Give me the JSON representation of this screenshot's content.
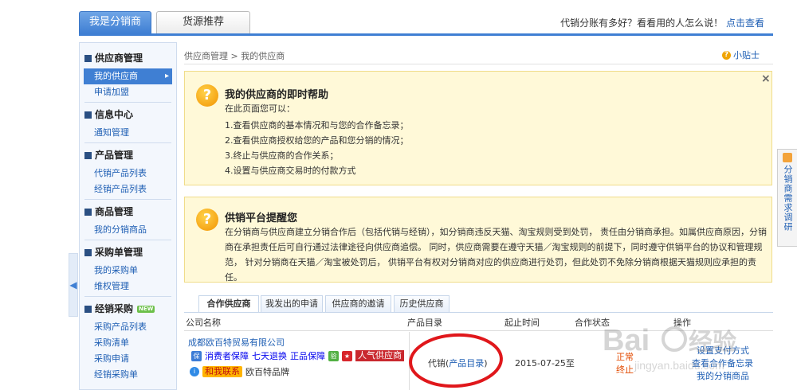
{
  "top_tabs": [
    {
      "label": "我是分销商"
    },
    {
      "label": "货源推荐"
    }
  ],
  "top_promo": {
    "text": "代销分账有多好？看看用的人怎么说！",
    "link": "点击查看"
  },
  "sidebar": {
    "groups": [
      {
        "title": "供应商管理",
        "items": [
          {
            "label": "我的供应商"
          },
          {
            "label": "申请加盟"
          }
        ]
      },
      {
        "title": "信息中心",
        "items": [
          {
            "label": "通知管理"
          }
        ]
      },
      {
        "title": "产品管理",
        "items": [
          {
            "label": "代销产品列表"
          },
          {
            "label": "经销产品列表"
          }
        ]
      },
      {
        "title": "商品管理",
        "items": [
          {
            "label": "我的分销商品"
          }
        ]
      },
      {
        "title": "采购单管理",
        "items": [
          {
            "label": "我的采购单"
          },
          {
            "label": "维权管理"
          }
        ]
      },
      {
        "title": "经销采购",
        "badge": "NEW",
        "items": [
          {
            "label": "采购产品列表"
          },
          {
            "label": "采购清单"
          },
          {
            "label": "采购申请"
          },
          {
            "label": "经销采购单"
          }
        ]
      }
    ]
  },
  "breadcrumb": {
    "parent": "供应商管理",
    "separator": ">",
    "current": "我的供应商"
  },
  "tips_label": "小贴士",
  "help_box_1": {
    "title": "我的供应商的即时帮助",
    "intro": "在此页面您可以：",
    "lines": [
      "1.查看供应商的基本情况和与您的合作备忘录；",
      "2.查看供应商授权给您的产品和您分销的情况；",
      "3.终止与供应商的合作关系；",
      "4.设置与供应商交易时的付款方式"
    ]
  },
  "help_box_2": {
    "title": "供销平台提醒您",
    "text": "在分销商与供应商建立分销合作后（包括代销与经销），如分销商违反天猫、淘宝规则受到处罚， 责任由分销商承担。如属供应商原因，分销商在承担责任后可自行通过法律途径向供应商追偿。 同时，供应商需要在遵守天猫／淘宝规则的前提下，同时遵守供销平台的协议和管理规范， 针对分销商在天猫／淘宝被处罚后， 供销平台有权对分销商对应的供应商进行处罚，但此处罚不免除分销商根据天猫规则应承担的责任。"
  },
  "close_glyph": "×",
  "side_feedback": "分销商需求调研",
  "sub_tabs": [
    {
      "label": "合作供应商"
    },
    {
      "label": "我发出的申请"
    },
    {
      "label": "供应商的邀请"
    },
    {
      "label": "历史供应商"
    }
  ],
  "table": {
    "headers": [
      "公司名称",
      "产品目录",
      "起止时间",
      "合作状态",
      "操作"
    ],
    "row": {
      "company": "成都欧百特贸易有限公司",
      "badges": [
        "消费者保障",
        "七天退换",
        "正品保障",
        "人气供应商"
      ],
      "contact_label": "和我联系",
      "brand": "欧百特品牌",
      "catalog_prefix": "代销(",
      "catalog_link": "产品目录",
      "catalog_suffix": ")",
      "date": "2015-07-25至",
      "status": [
        "正常",
        "终止"
      ],
      "ops": [
        "设置支付方式",
        "查看合作备忘录",
        "我的分销商品"
      ]
    }
  },
  "colors": {
    "accent": "#3f7fd3",
    "link": "#1f5fb4",
    "help_bg": "#fff9d8",
    "status": "#e24a00",
    "annotation_circle": "#e0171b"
  }
}
